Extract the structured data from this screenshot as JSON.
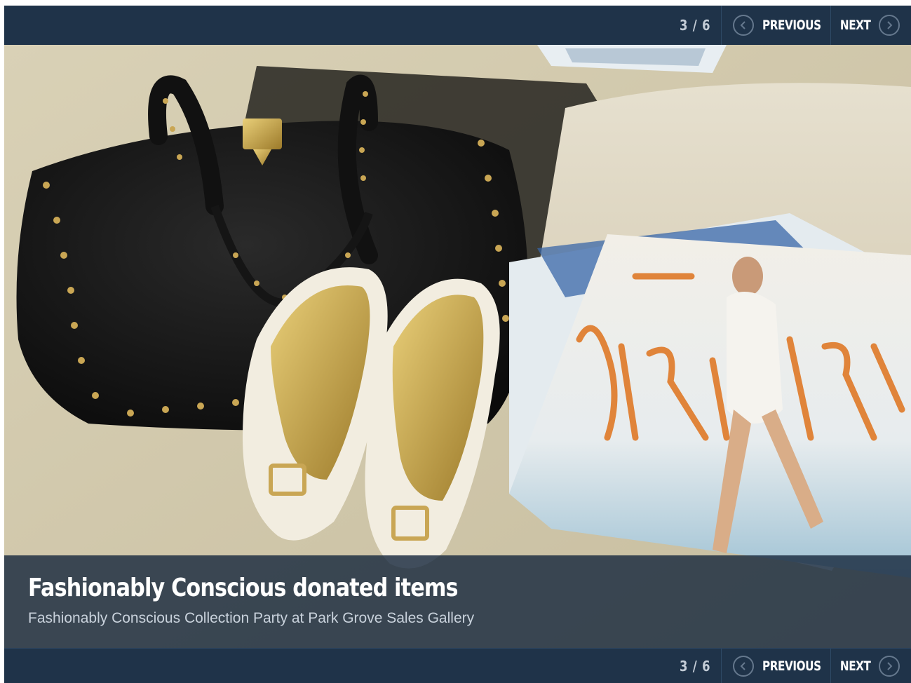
{
  "gallery": {
    "counter": "3 / 6",
    "previous_label": "PREVIOUS",
    "next_label": "NEXT"
  },
  "slide": {
    "title": "Fashionably Conscious donated items",
    "subtitle": "Fashionably Conscious Collection Party at Park Grove Sales Gallery"
  },
  "icons": {
    "previous": "chevron-left-circle-icon",
    "next": "chevron-right-circle-icon"
  },
  "colors": {
    "bar_background": "#1f3349",
    "caption_background": "#182a3e",
    "text": "#ffffff"
  }
}
